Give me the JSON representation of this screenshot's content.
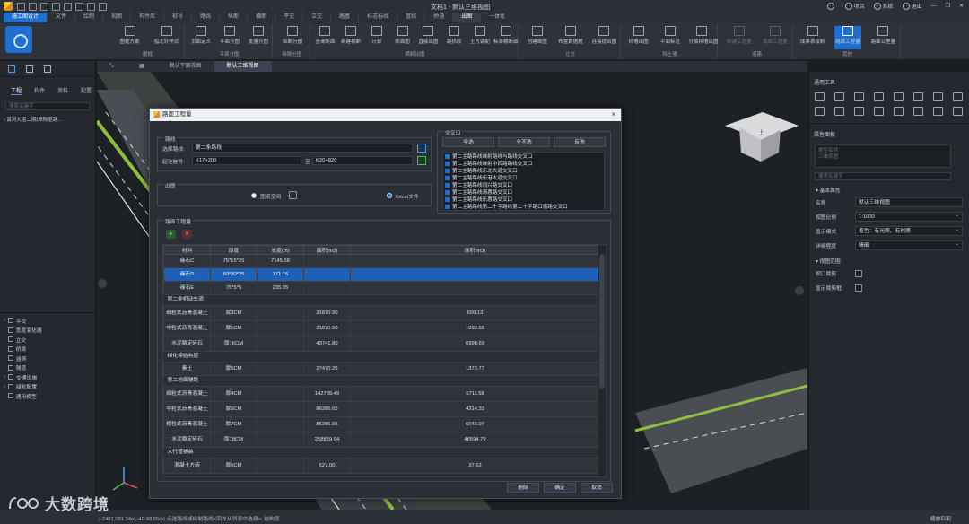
{
  "titlebar": {
    "document_title": "文档1 - 默认三维视图",
    "project_label": "项目",
    "system_label": "系统",
    "logout_label": "退出"
  },
  "ribbon_tabs": [
    "施工图设计",
    "文件",
    "绘制",
    "视图",
    "构件库",
    "桩号",
    "路线",
    "纵断",
    "横断",
    "平交",
    "立交",
    "路基",
    "标志标线",
    "管线",
    "桥涵",
    "出图",
    "一体化"
  ],
  "active_ribbon_tab": "出图",
  "ribbon_groups": [
    {
      "label": "图框",
      "buttons": [
        "图框方案",
        "指北针样式"
      ]
    },
    {
      "label": "平面分图",
      "buttons": [
        "页面定义",
        "平面分图",
        "批量分图"
      ]
    },
    {
      "label": "纵断分图",
      "buttons": [
        "纵断分图"
      ]
    },
    {
      "label": "横断出图",
      "buttons": [
        "查询断面",
        "新建横断",
        "计算",
        "断面图",
        "直接出图",
        "路拱段",
        "土方调配",
        "标准横断面"
      ]
    },
    {
      "label": "立交",
      "buttons": [
        "创建单图",
        "布置数据框",
        "连接提出图"
      ]
    },
    {
      "label": "挡土墙",
      "buttons": [
        "挡墙出图",
        "平面标注",
        "分解挡墙出图"
      ]
    },
    {
      "label": "道路",
      "buttons": [
        "新建工程量",
        "路面工程量"
      ]
    },
    {
      "label": "其他",
      "buttons": [
        "成果表绘制",
        "路面工程量",
        "路面公里量"
      ]
    }
  ],
  "left_panel": {
    "tabs": [
      "工程",
      "构件",
      "资料",
      "配置"
    ],
    "active_tab": "工程",
    "search_placeholder": "搜索关键字",
    "tree_root": "黄河大道二期(昂际道路...",
    "list_items": [
      "平交",
      "宽度变化器",
      "立交",
      "桥梁",
      "涵洞",
      "隧道",
      "交通设施",
      "绿化配置",
      "通用模型"
    ]
  },
  "doc_tabs": [
    "默认平面视图",
    "默认三维视图"
  ],
  "active_doc_tab": "默认三维视图",
  "right_panel": {
    "common_tools_title": "通用工具",
    "props_title": "属性面板",
    "box_placeholder_1": "类型名称",
    "box_placeholder_2": "三维视图",
    "search_placeholder": "搜索关键字",
    "basic_props_title": "基本属性",
    "properties": [
      {
        "key": "名称",
        "value": "默认三维视图",
        "dropdown": false
      },
      {
        "key": "视图比例",
        "value": "1:1000",
        "dropdown": true
      },
      {
        "key": "显示模式",
        "value": "着色：有光照、有材质",
        "dropdown": true
      },
      {
        "key": "详细程度",
        "value": "精细",
        "dropdown": true
      }
    ],
    "view_range_title": "视图范围",
    "view_range_props": [
      "视口裁剪",
      "显示裁剪框"
    ]
  },
  "dialog": {
    "title": "路面工程量",
    "close_symbol": "×",
    "route_section": {
      "legend": "路线",
      "select_route_label": "选择路线:",
      "select_route_value": "第二条路线",
      "station_label": "起讫桩号:",
      "station_start": "K17+200",
      "to_label": "至",
      "station_end": "K20+820"
    },
    "output_section": {
      "legend": "出图",
      "option_1": "图纸空间",
      "option_2": "Excel文件",
      "selected": "Excel文件"
    },
    "junction_section": {
      "legend": "交叉口",
      "select_all": "全选",
      "select_none": "全不选",
      "invert": "反选",
      "items": [
        "第二主路路线映射路线与路线交叉口",
        "第二主路路线映射中西路路线交叉口",
        "第二主路路线乐北大道交叉口",
        "第二主路路线乐港大道交叉口",
        "第二主路路线同兴路交叉口",
        "第二主路路线涛惠路交叉口",
        "第二主路路线乐惠路交叉口",
        "第二主路路线第二十字路线第二十字路口道路交叉口"
      ]
    },
    "quantities_section": {
      "legend": "路面工程量",
      "add_symbol": "+",
      "delete_symbol": "×",
      "headers": [
        "材料",
        "厚度",
        "长度(m)",
        "面积(m2)",
        "体积(m3)"
      ],
      "rows": [
        {
          "type": "row",
          "material": "缘石C",
          "thickness": "75*15*25",
          "length": "7145.58",
          "area": "",
          "volume": ""
        },
        {
          "type": "row",
          "material": "缘石D",
          "thickness": "50*30*25",
          "length": "171.15",
          "area": "",
          "volume": "",
          "selected": true
        },
        {
          "type": "row",
          "material": "缘石E",
          "thickness": "75*5*5",
          "length": "235.05",
          "area": "",
          "volume": ""
        },
        {
          "type": "group",
          "label": "第二非机动车道"
        },
        {
          "type": "row",
          "material": "细粒式沥青混凝土",
          "thickness": "厚3CM",
          "length": "",
          "area": "21870.90",
          "volume": "656.13"
        },
        {
          "type": "row",
          "material": "中粒式沥青混凝土",
          "thickness": "厚5CM",
          "length": "",
          "area": "21870.90",
          "volume": "1093.55"
        },
        {
          "type": "row",
          "material": "水泥稳定碎石",
          "thickness": "厚16CM",
          "length": "",
          "area": "43741.80",
          "volume": "6998.69"
        },
        {
          "type": "group",
          "label": "绿化带结构层"
        },
        {
          "type": "row",
          "material": "素土",
          "thickness": "厚5CM",
          "length": "",
          "area": "27470.25",
          "volume": "1373.77"
        },
        {
          "type": "group",
          "label": "第二地面辅路"
        },
        {
          "type": "row",
          "material": "细粒式沥青混凝土",
          "thickness": "厚4CM",
          "length": "",
          "area": "142789.49",
          "volume": "5711.58"
        },
        {
          "type": "row",
          "material": "中粒式沥青混凝土",
          "thickness": "厚5CM",
          "length": "",
          "area": "86286.65",
          "volume": "4314.33"
        },
        {
          "type": "row",
          "material": "粗粒式沥青混凝土",
          "thickness": "厚7CM",
          "length": "",
          "area": "86286.65",
          "volume": "6040.07"
        },
        {
          "type": "row",
          "material": "水泥稳定碎石",
          "thickness": "厚18CM",
          "length": "",
          "area": "258859.94",
          "volume": "46594.79"
        },
        {
          "type": "group",
          "label": "人行道铺装"
        },
        {
          "type": "row",
          "material": "混凝土方砖",
          "thickness": "厚6CM",
          "length": "",
          "area": "627.00",
          "volume": "37.62"
        }
      ]
    },
    "footer_buttons": [
      "删除",
      "确定",
      "取消"
    ]
  },
  "statusbar": {
    "text": "(-2481,081.24m,-40-98.65m) 点选路线或绘制路线<回车从列表中选择>: 结构层",
    "zoom_label": "缩放匹配"
  },
  "watermark": {
    "text": "大数跨境"
  }
}
